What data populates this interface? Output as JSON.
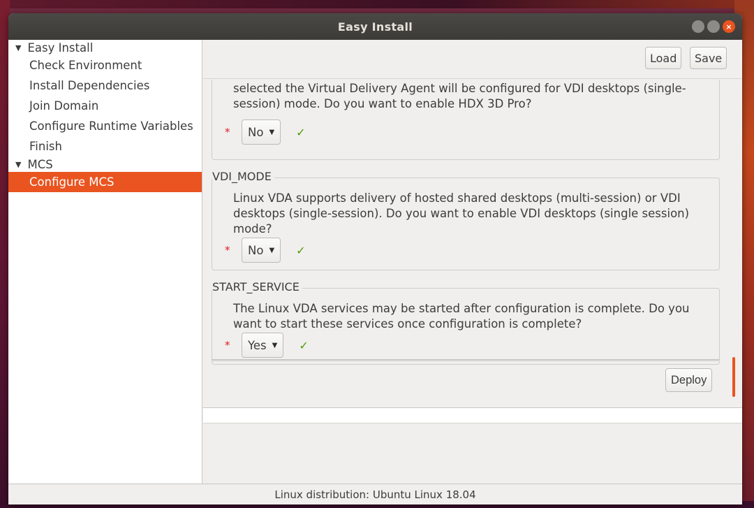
{
  "window": {
    "title": "Easy Install",
    "controls": {
      "minimize_icon": "minimize-icon",
      "maximize_icon": "maximize-icon",
      "close_icon": "close-icon",
      "close_glyph": "×"
    }
  },
  "sidebar": {
    "groups": [
      {
        "label": "Easy Install",
        "expanded": true,
        "items": [
          {
            "label": "Check Environment"
          },
          {
            "label": "Install Dependencies"
          },
          {
            "label": "Join Domain"
          },
          {
            "label": "Configure Runtime Variables"
          },
          {
            "label": "Finish"
          }
        ]
      },
      {
        "label": "MCS",
        "expanded": true,
        "items": [
          {
            "label": "Configure MCS",
            "selected": true
          }
        ]
      }
    ]
  },
  "toolbar": {
    "load_label": "Load",
    "save_label": "Save"
  },
  "sections": [
    {
      "label": "",
      "description": "selected the Virtual Delivery Agent will be configured for VDI desktops (single-session) mode. Do you want to enable HDX 3D Pro?",
      "required_mark": "*",
      "value": "No",
      "valid_mark": "✓"
    },
    {
      "label": "VDI_MODE",
      "description": "Linux VDA supports delivery of hosted shared desktops (multi-session) or VDI desktops (single-session). Do you want to enable VDI desktops (single session) mode?",
      "required_mark": "*",
      "value": "No",
      "valid_mark": "✓"
    },
    {
      "label": "START_SERVICE",
      "description": "The Linux VDA services may be started after configuration is complete. Do you want to start these services once configuration is complete?",
      "required_mark": "*",
      "value": "Yes",
      "valid_mark": "✓"
    }
  ],
  "deploy_label": "Deploy",
  "status": {
    "text": "Linux distribution: Ubuntu Linux 18.04"
  },
  "colors": {
    "accent": "#e95420",
    "valid": "#4e9a06",
    "required": "#e01b24"
  }
}
